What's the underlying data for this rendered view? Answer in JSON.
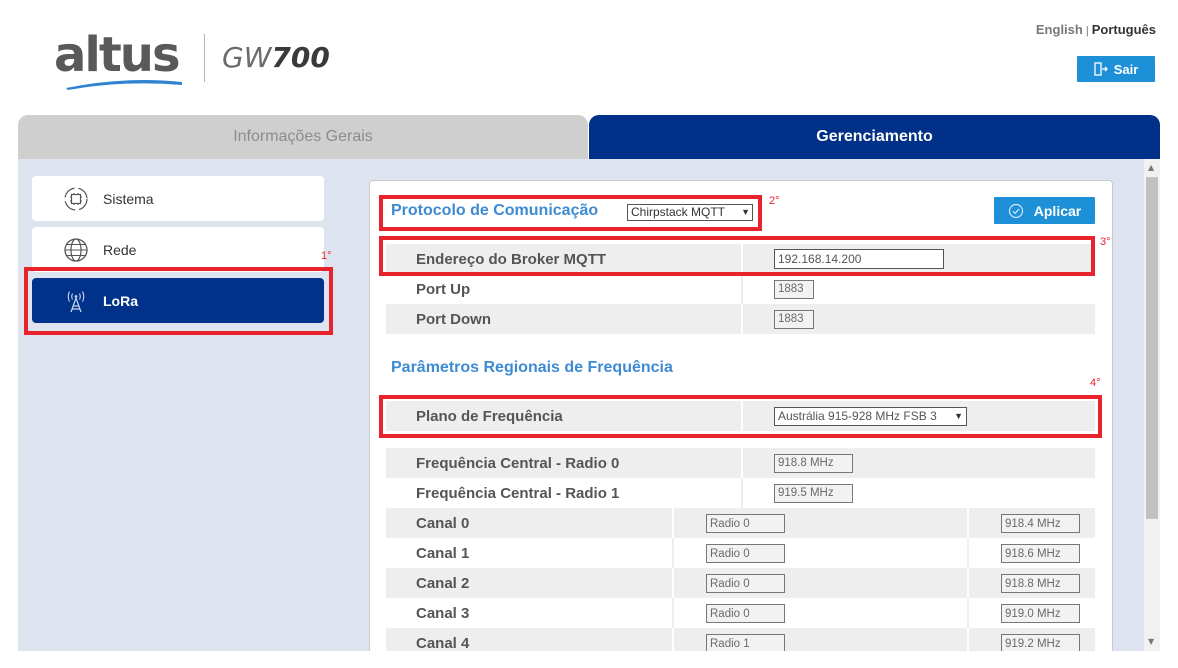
{
  "header": {
    "brand": "altus",
    "product_prefix": "GW",
    "product_number": "700",
    "lang_english": "English",
    "lang_separator": "|",
    "lang_portuguese": "Português",
    "logout_label": "Sair",
    "logout_icon": "logout-icon"
  },
  "tabs": [
    {
      "label": "Informações Gerais",
      "active": false
    },
    {
      "label": "Gerenciamento",
      "active": true
    }
  ],
  "sidebar": {
    "items": [
      {
        "label": "Sistema",
        "icon": "chip-icon",
        "active": false
      },
      {
        "label": "Rede",
        "icon": "globe-icon",
        "active": false
      },
      {
        "label": "LoRa",
        "icon": "antenna-icon",
        "active": true
      }
    ]
  },
  "annotations": {
    "n1": "1°",
    "n2": "2°",
    "n3": "3°",
    "n4": "4°"
  },
  "colors": {
    "primary": "#003087",
    "accent": "#1e90d8",
    "highlight": "#e8232b",
    "section_title": "#3e8bd3"
  },
  "protocol": {
    "title": "Protocolo de Comunicação",
    "selected": "Chirpstack MQTT",
    "apply_label": "Aplicar",
    "broker_label": "Endereço do Broker MQTT",
    "broker_value": "192.168.14.200",
    "port_up_label": "Port Up",
    "port_up_value": "1883",
    "port_down_label": "Port Down",
    "port_down_value": "1883"
  },
  "regional": {
    "title": "Parâmetros Regionais de Frequência",
    "plan_label": "Plano de Frequência",
    "plan_selected": "Austrália 915-928 MHz FSB 3",
    "radio0_label": "Frequência Central - Radio 0",
    "radio0_value": "918.8 MHz",
    "radio1_label": "Frequência Central - Radio 1",
    "radio1_value": "919.5 MHz",
    "channels": [
      {
        "label": "Canal 0",
        "radio": "Radio 0",
        "freq": "918.4 MHz"
      },
      {
        "label": "Canal 1",
        "radio": "Radio 0",
        "freq": "918.6 MHz"
      },
      {
        "label": "Canal 2",
        "radio": "Radio 0",
        "freq": "918.8 MHz"
      },
      {
        "label": "Canal 3",
        "radio": "Radio 0",
        "freq": "919.0 MHz"
      },
      {
        "label": "Canal 4",
        "radio": "Radio 1",
        "freq": "919.2 MHz"
      }
    ]
  }
}
